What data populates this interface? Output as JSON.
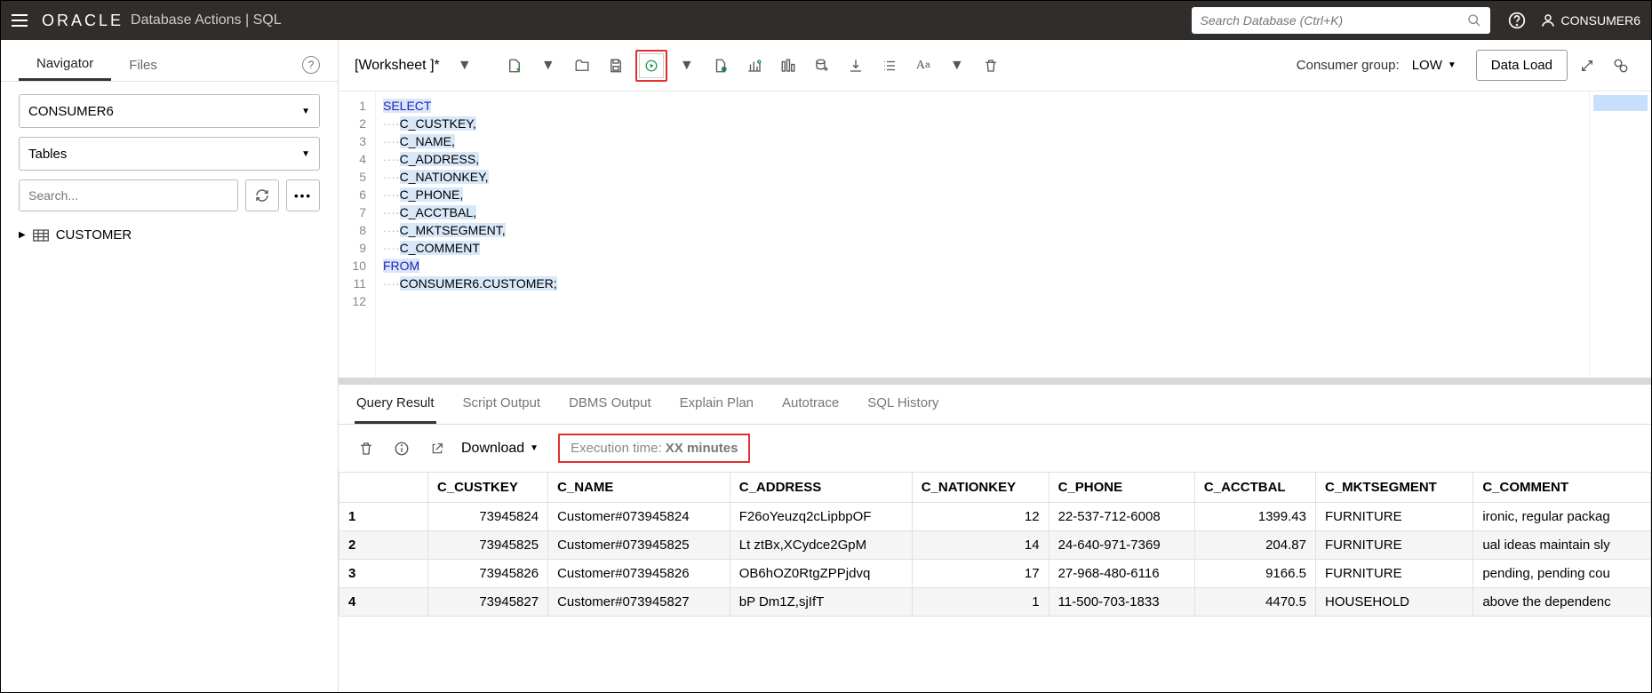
{
  "header": {
    "logo": "ORACLE",
    "product": "Database Actions",
    "section": "SQL",
    "search_placeholder": "Search Database (Ctrl+K)",
    "username": "CONSUMER6"
  },
  "sidebar": {
    "tabs": [
      "Navigator",
      "Files"
    ],
    "schema": "CONSUMER6",
    "object_type": "Tables",
    "search_placeholder": "Search...",
    "tree_item": "CUSTOMER"
  },
  "toolbar": {
    "worksheet": "[Worksheet ]*",
    "consumer_group_label": "Consumer group:",
    "consumer_group_value": "LOW",
    "data_load": "Data Load"
  },
  "editor": {
    "lines": [
      "1",
      "2",
      "3",
      "4",
      "5",
      "6",
      "7",
      "8",
      "9",
      "10",
      "11",
      "12"
    ],
    "code": [
      {
        "t": "kw",
        "v": "SELECT"
      },
      {
        "t": "col",
        "v": "C_CUSTKEY,"
      },
      {
        "t": "col",
        "v": "C_NAME,"
      },
      {
        "t": "col",
        "v": "C_ADDRESS,"
      },
      {
        "t": "col",
        "v": "C_NATIONKEY,"
      },
      {
        "t": "col",
        "v": "C_PHONE,"
      },
      {
        "t": "col",
        "v": "C_ACCTBAL,"
      },
      {
        "t": "col",
        "v": "C_MKTSEGMENT,"
      },
      {
        "t": "col",
        "v": "C_COMMENT"
      },
      {
        "t": "kw",
        "v": "FROM"
      },
      {
        "t": "tbl",
        "v": "CONSUMER6.CUSTOMER;"
      }
    ]
  },
  "results": {
    "tabs": [
      "Query Result",
      "Script Output",
      "DBMS Output",
      "Explain Plan",
      "Autotrace",
      "SQL History"
    ],
    "download": "Download",
    "exec_label": "Execution time:",
    "exec_value": "XX minutes",
    "columns": [
      "C_CUSTKEY",
      "C_NAME",
      "C_ADDRESS",
      "C_NATIONKEY",
      "C_PHONE",
      "C_ACCTBAL",
      "C_MKTSEGMENT",
      "C_COMMENT"
    ],
    "rows": [
      {
        "n": "1",
        "c": [
          "73945824",
          "Customer#073945824",
          "F26oYeuzq2cLipbpOF",
          "12",
          "22-537-712-6008",
          "1399.43",
          "FURNITURE",
          "ironic, regular packag"
        ]
      },
      {
        "n": "2",
        "c": [
          "73945825",
          "Customer#073945825",
          "Lt ztBx,XCydce2GpM",
          "14",
          "24-640-971-7369",
          "204.87",
          "FURNITURE",
          "ual ideas maintain sly"
        ]
      },
      {
        "n": "3",
        "c": [
          "73945826",
          "Customer#073945826",
          "OB6hOZ0RtgZPPjdvq",
          "17",
          "27-968-480-6116",
          "9166.5",
          "FURNITURE",
          "pending, pending cou"
        ]
      },
      {
        "n": "4",
        "c": [
          "73945827",
          "Customer#073945827",
          "bP Dm1Z,sjIfT",
          "1",
          "11-500-703-1833",
          "4470.5",
          "HOUSEHOLD",
          "above the dependenc"
        ]
      }
    ]
  }
}
